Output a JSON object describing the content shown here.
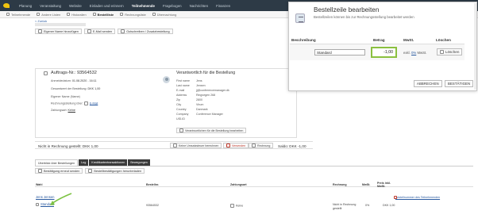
{
  "topnav": {
    "items": [
      "Planung",
      "Veranstaltung",
      "Website",
      "Einladen und erinnern",
      "Teilnehmende",
      "Fragebogen",
      "Nachrichten",
      "Finanzen"
    ],
    "active_index": 4
  },
  "subnav": {
    "items": [
      "Teilnehmende",
      "Andere Listen",
      "Historalien",
      "Bestellliste",
      "Rechnungsliste",
      "Übernachtung"
    ],
    "active_index": 3
  },
  "back_link": "< Zurück",
  "toolbar": {
    "buttons": [
      "Eigener Name hinzufügen",
      "E-Mail senden",
      "Gutschreiben / Zusatzbestellung"
    ]
  },
  "order": {
    "title": "Auftrags-Nr.: 93564532",
    "fields": [
      {
        "label": "Anmeldedatum:",
        "value": "01.08.2020 - 16:11"
      },
      {
        "label": "Gesamtwert der Bestellung:",
        "value": "DKK 1,00"
      },
      {
        "label": "Eigener Name (Name)",
        "value": ""
      },
      {
        "label": "Rechnungsstellung über:",
        "value": "E-Mail"
      },
      {
        "label": "Zahlungsart:",
        "value": "Keine"
      }
    ]
  },
  "responsible": {
    "title": "Verantwortlich für die Bestellung",
    "fields": [
      {
        "label": "First name",
        "value": "Jens"
      },
      {
        "label": "Last name",
        "value": "Jensen"
      },
      {
        "label": "E-mail",
        "value": "jj@conferencemanager.dk"
      },
      {
        "label": "Address",
        "value": "Ringvegen 268"
      },
      {
        "label": "Zip",
        "value": "2800"
      },
      {
        "label": "City",
        "value": "Virum"
      },
      {
        "label": "Country",
        "value": "Danmark"
      },
      {
        "label": "Company",
        "value": "Conference Manager"
      },
      {
        "label": "UID-ID",
        "value": ""
      }
    ],
    "change_button": "Verantwortlichen für die Bestellung bearbeiten"
  },
  "balance_bar": {
    "not_invoiced": "Nicht in Rechnung gestellt: DKK 1,00",
    "calc_button": "Keine Umsatzsteuer berechnen",
    "send_button": "Versenden",
    "invoice_button": "Rechnung",
    "saldo": "Saldo: DKK -1,00"
  },
  "tabs": {
    "items": [
      "Überblick über Bestellungen",
      "Log",
      "Kreditkartentransaktionen",
      "Bewegungen"
    ],
    "active_index": 0,
    "actions": [
      "Bestätigung erneut senden",
      "Bestellbestätigungen herunterladen"
    ]
  },
  "table": {
    "headers": [
      "Wahl",
      "Bestellnr.",
      "Zahlungsart",
      "Rechnung",
      "MwSt.",
      "Preis inkl. MwSt."
    ],
    "person": "Jens Jensen",
    "person_link": "Bestellnummer des Teilnehmenden",
    "row": {
      "name": "Standard",
      "order_no": "93564532",
      "payment": "Keine",
      "invoice": "Nicht in Rechnung gestellt",
      "vat": "0%",
      "price": "DKK 1,00"
    }
  },
  "modal": {
    "title": "Bestellzeile bearbeiten",
    "subtitle": "Bestellzeilen können bis zur Rechnungsstellung bearbeitet werden",
    "headers": [
      "Beschreibung",
      "Betrag",
      "MwSt.",
      "Löschen"
    ],
    "description_value": "Standard",
    "amount_value": "-1,00",
    "vat_prefix": "exkl.",
    "vat_rate": "0%",
    "vat_suffix": "MwSt.",
    "delete_button": "Löschen",
    "cancel_button": "ABBRECHEN",
    "confirm_button": "BESTÄTIGEN"
  },
  "colors": {
    "nav_bg": "#2d3a46",
    "highlight": "#8ac03f",
    "link": "#2a5aa0",
    "arrow": "#7cc242"
  }
}
